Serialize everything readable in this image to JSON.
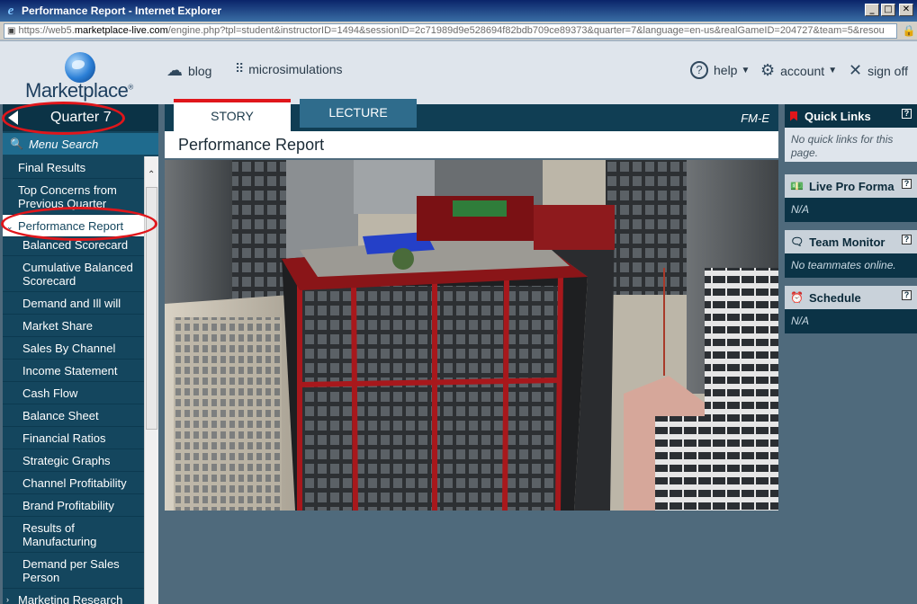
{
  "window": {
    "title": "Performance Report - Internet Explorer",
    "url_prefix": "https://web5.",
    "url_host": "marketplace-live.com",
    "url_rest": "/engine.php?tpl=student&instructorID=1494&sessionID=2c71989d9e528694f82bdb709ce89373&quarter=7&language=en-us&realGameID=204727&team=5&resou"
  },
  "header": {
    "logo_text": "Marketplace",
    "nav_left": [
      {
        "label": "blog",
        "icon": "cloud-upload-icon"
      },
      {
        "label": "microsimulations",
        "icon": "grid-dots-icon"
      }
    ],
    "nav_right": [
      {
        "label": "help",
        "icon": "question-circle-icon"
      },
      {
        "label": "account",
        "icon": "gear-icon"
      },
      {
        "label": "sign off",
        "icon": "x-icon"
      }
    ]
  },
  "sidebar": {
    "quarter_label": "Quarter 7",
    "menu_search_label": "Menu Search",
    "items": [
      {
        "label": "Final Results",
        "level": 0
      },
      {
        "label": "Top Concerns from Previous Quarter",
        "level": 0
      },
      {
        "label": "Performance Report",
        "level": 0,
        "active": true
      },
      {
        "label": "Balanced Scorecard",
        "level": 1
      },
      {
        "label": "Cumulative Balanced Scorecard",
        "level": 1
      },
      {
        "label": "Demand and Ill will",
        "level": 1
      },
      {
        "label": "Market Share",
        "level": 1
      },
      {
        "label": "Sales By Channel",
        "level": 1
      },
      {
        "label": "Income Statement",
        "level": 1
      },
      {
        "label": "Cash Flow",
        "level": 1
      },
      {
        "label": "Balance Sheet",
        "level": 1
      },
      {
        "label": "Financial Ratios",
        "level": 1
      },
      {
        "label": "Strategic Graphs",
        "level": 1
      },
      {
        "label": "Channel Profitability",
        "level": 1
      },
      {
        "label": "Brand Profitability",
        "level": 1
      },
      {
        "label": "Results of Manufacturing",
        "level": 1
      },
      {
        "label": "Demand per Sales Person",
        "level": 1
      },
      {
        "label": "Marketing Research",
        "level": 0
      }
    ]
  },
  "main": {
    "tabs": [
      "STORY",
      "LECTURE"
    ],
    "active_tab": "STORY",
    "tab_code": "FM-E",
    "title": "Performance Report",
    "illustration": "city-skyscraper-illustration"
  },
  "right_panels": {
    "quick_links": {
      "title": "Quick Links",
      "body": "No quick links for this page."
    },
    "live_pro_forma": {
      "title": "Live Pro Forma",
      "body": "N/A"
    },
    "team_monitor": {
      "title": "Team Monitor",
      "body": "No teammates online."
    },
    "schedule": {
      "title": "Schedule",
      "body": "N/A"
    }
  },
  "colors": {
    "accent_red": "#e0161b",
    "sidebar_bg": "#14465e",
    "tab_bar": "#103e54",
    "page_bg": "#4f6a7c"
  }
}
